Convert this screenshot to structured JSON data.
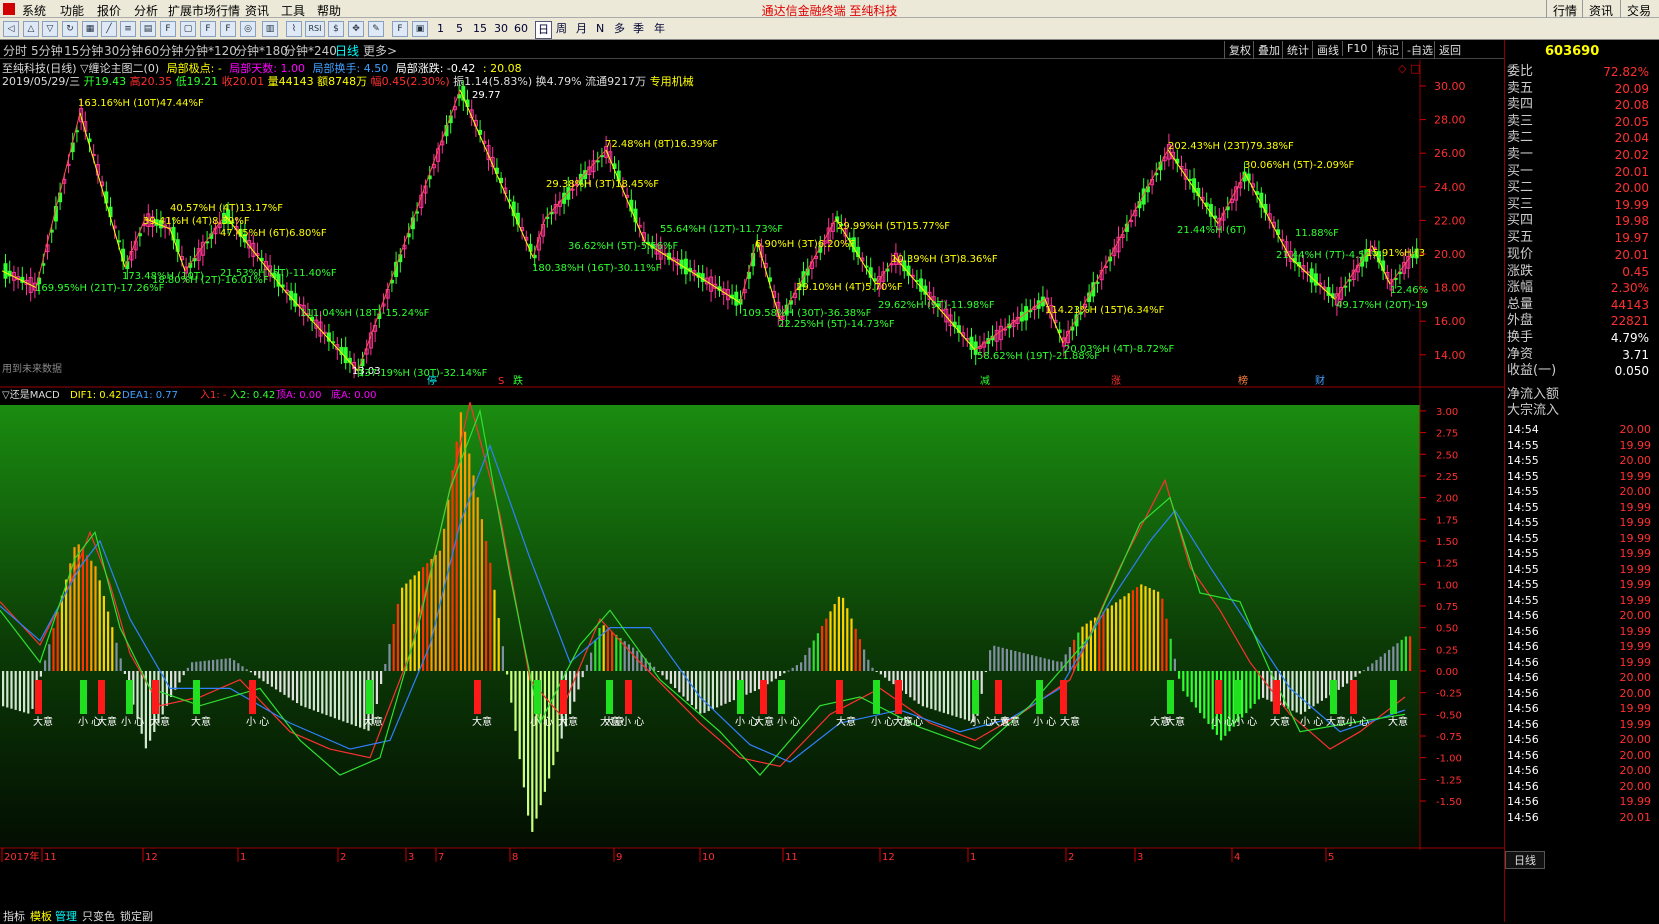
{
  "menu": {
    "items": [
      "系统",
      "功能",
      "报价",
      "分析",
      "扩展市场行情",
      "资讯",
      "工具",
      "帮助"
    ],
    "title": "通达信金融终端  至纯科技",
    "right": [
      "行情",
      "资讯",
      "交易"
    ]
  },
  "toolbar": {
    "nums": [
      "1",
      "5",
      "15",
      "30",
      "60"
    ],
    "periods": [
      "日",
      "周",
      "月",
      "N",
      "多",
      "季",
      "年"
    ]
  },
  "periods": {
    "items": [
      "分时",
      "5分钟",
      "15分钟",
      "30分钟",
      "60分钟",
      "分钟*120",
      "分钟*180",
      "分钟*240",
      "日线",
      "更多>"
    ],
    "active": "日线",
    "right": [
      "复权",
      "叠加",
      "统计",
      "画线",
      "F10",
      "标记",
      "-自选",
      "返回"
    ]
  },
  "stock_code": "603690",
  "info": {
    "line1_name": "至纯科技(日线) ▽缠论主图二(0)",
    "l1": "局部极点: -",
    "l2": "局部天数: 1.00",
    "l3": "局部换手: 4.50",
    "l4": "局部涨跌: -0.42",
    "l5": ": 20.08",
    "date": "2019/05/29/三",
    "open": "开19.43",
    "high": "高20.35",
    "low": "低19.21",
    "close": "收20.01",
    "vol": "量44143",
    "amt": "额8748万",
    "chg": "幅0.45(2.30%)",
    "amp": "振1.14(5.83%)",
    "turn": "换4.79%",
    "flow": "流通9217万",
    "tag": "专用机械"
  },
  "main_labels": [
    {
      "t": "163.16%H (10T)47.44%F",
      "c": "#ffff00"
    },
    {
      "t": "169.95%H (21T)-17.26%F",
      "c": "#30ff30"
    },
    {
      "t": "39.41%H (4T)8.39%F",
      "c": "#ffff00"
    },
    {
      "t": "40.57%H (4T)13.17%F",
      "c": "#ffff00"
    },
    {
      "t": "47.45%H (6T)6.80%F",
      "c": "#ffff00"
    },
    {
      "t": "173.48%H (10T)",
      "c": "#30ff30"
    },
    {
      "t": "18.80%H (2T)-16.01%F",
      "c": "#30ff30"
    },
    {
      "t": "21.53%H (5T)-11.40%F",
      "c": "#30ff30"
    },
    {
      "t": "111.04%H (18T)-15.24%F",
      "c": "#30ff30"
    },
    {
      "t": "13.03",
      "c": "#ffffff"
    },
    {
      "t": "137.19%H (30T)-32.14%F",
      "c": "#30ff30"
    },
    {
      "t": "29.77",
      "c": "#ffffff"
    },
    {
      "t": "29.38%H (3T)18.45%F",
      "c": "#ffff00"
    },
    {
      "t": "72.48%H (8T)16.39%F",
      "c": "#ffff00"
    },
    {
      "t": "36.62%H (5T)-5.56%F",
      "c": "#30ff30"
    },
    {
      "t": "180.38%H (16T)-30.11%F",
      "c": "#30ff30"
    },
    {
      "t": "55.64%H (12T)-11.73%F",
      "c": "#30ff30"
    },
    {
      "t": "6.90%H (3T)6.20%F",
      "c": "#ffff00"
    },
    {
      "t": "29.99%H (5T)15.77%F",
      "c": "#ffff00"
    },
    {
      "t": "29.10%H (4T)5.70%F",
      "c": "#ffff00"
    },
    {
      "t": "109.58%H (30T)-36.38%F",
      "c": "#30ff30"
    },
    {
      "t": "22.25%H (5T)-14.73%F",
      "c": "#30ff30"
    },
    {
      "t": "10.39%H (3T)8.36%F",
      "c": "#ffff00"
    },
    {
      "t": "29.62%H (9T)-11.98%F",
      "c": "#30ff30"
    },
    {
      "t": "114.23%H (15T)6.34%F",
      "c": "#ffff00"
    },
    {
      "t": "58.62%H (19T)-21.88%F",
      "c": "#30ff30"
    },
    {
      "t": "20.03%H (4T)-8.72%F",
      "c": "#30ff30"
    },
    {
      "t": "202.43%H (23T)79.38%F",
      "c": "#ffff00"
    },
    {
      "t": "30.06%H (5T)-2.09%F",
      "c": "#ffff00"
    },
    {
      "t": "21.44%H (6T)",
      "c": "#30ff30"
    },
    {
      "t": "11.88%F",
      "c": "#30ff30"
    },
    {
      "t": "21.44%H (7T)-4.57%",
      "c": "#30ff30"
    },
    {
      "t": "15.91%H (3",
      "c": "#ffff00"
    },
    {
      "t": "12.46%",
      "c": "#30ff30"
    },
    {
      "t": "49.17%H (20T)-19",
      "c": "#30ff30"
    }
  ],
  "future_note": "用到未来数据",
  "event_tags": [
    "停",
    "S",
    "跌",
    "减",
    "涨",
    "榜",
    "财"
  ],
  "macd": {
    "title": "▽还是MACD",
    "dif": "DIF1: 0.42",
    "dea": "DEA1: 0.77",
    "in1": "入1: -",
    "in2": "入2: 0.42",
    "top": "顶A: 0.00",
    "bottom": "底A: 0.00"
  },
  "main_axis": [
    "30.00",
    "28.00",
    "26.00",
    "24.00",
    "22.00",
    "20.00",
    "18.00",
    "16.00",
    "14.00"
  ],
  "macd_axis": [
    "3.00",
    "2.75",
    "2.50",
    "2.25",
    "2.00",
    "1.75",
    "1.50",
    "1.25",
    "1.00",
    "0.75",
    "0.50",
    "0.25",
    "0.00",
    "-0.25",
    "-0.50",
    "-0.75",
    "-1.00",
    "-1.25",
    "-1.50"
  ],
  "signals": [
    "大意",
    "小 心",
    "大意",
    "小 心",
    "大意",
    "大意",
    "小 心",
    "大意",
    "大意",
    "小 心",
    "大意",
    "大意",
    "小 心",
    "小 心",
    "大意",
    "小 心",
    "大意",
    "小 心",
    "大意",
    "小 心",
    "大意",
    "小 心",
    "大意",
    "大意",
    "小 心",
    "小 心",
    "大意",
    "大意",
    "小 心",
    "大意",
    "大意",
    "小 心",
    "大意",
    "小 心",
    "大意"
  ],
  "months": [
    "2017年",
    "11",
    "12",
    "1",
    "2",
    "3",
    "7",
    "8",
    "9",
    "10",
    "11",
    "12",
    "1",
    "2",
    "3",
    "4",
    "5"
  ],
  "sidebar": {
    "rows": [
      {
        "k": "委比",
        "v": "72.82%"
      },
      {
        "k": "卖五",
        "v": "20.09"
      },
      {
        "k": "卖四",
        "v": "20.08"
      },
      {
        "k": "卖三",
        "v": "20.05"
      },
      {
        "k": "卖二",
        "v": "20.04"
      },
      {
        "k": "卖一",
        "v": "20.02"
      },
      {
        "k": "买一",
        "v": "20.01"
      },
      {
        "k": "买二",
        "v": "20.00"
      },
      {
        "k": "买三",
        "v": "19.99"
      },
      {
        "k": "买四",
        "v": "19.98"
      },
      {
        "k": "买五",
        "v": "19.97"
      },
      {
        "k": "现价",
        "v": "20.01"
      },
      {
        "k": "涨跌",
        "v": "0.45"
      },
      {
        "k": "涨幅",
        "v": "2.30%"
      },
      {
        "k": "总量",
        "v": "44143"
      },
      {
        "k": "外盘",
        "v": "22821"
      },
      {
        "k": "换手",
        "v": "4.79%"
      },
      {
        "k": "净资",
        "v": "3.71"
      },
      {
        "k": "收益(一)",
        "v": "0.050"
      }
    ],
    "flow1": "净流入额",
    "flow2": "大宗流入",
    "ticks": [
      [
        "14:54",
        "20.00"
      ],
      [
        "14:55",
        "19.99"
      ],
      [
        "14:55",
        "20.00"
      ],
      [
        "14:55",
        "19.99"
      ],
      [
        "14:55",
        "20.00"
      ],
      [
        "14:55",
        "19.99"
      ],
      [
        "14:55",
        "19.99"
      ],
      [
        "14:55",
        "19.99"
      ],
      [
        "14:55",
        "19.99"
      ],
      [
        "14:55",
        "19.99"
      ],
      [
        "14:55",
        "19.99"
      ],
      [
        "14:55",
        "19.99"
      ],
      [
        "14:56",
        "20.00"
      ],
      [
        "14:56",
        "19.99"
      ],
      [
        "14:56",
        "19.99"
      ],
      [
        "14:56",
        "19.99"
      ],
      [
        "14:56",
        "20.00"
      ],
      [
        "14:56",
        "20.00"
      ],
      [
        "14:56",
        "19.99"
      ],
      [
        "14:56",
        "19.99"
      ],
      [
        "14:56",
        "20.00"
      ],
      [
        "14:56",
        "20.00"
      ],
      [
        "14:56",
        "20.00"
      ],
      [
        "14:56",
        "20.00"
      ],
      [
        "14:56",
        "19.99"
      ],
      [
        "14:56",
        "20.01"
      ]
    ],
    "bottom_tab": "日线"
  },
  "bottom": [
    "指标",
    "模板",
    "管理",
    "只变色",
    "锁定副"
  ]
}
